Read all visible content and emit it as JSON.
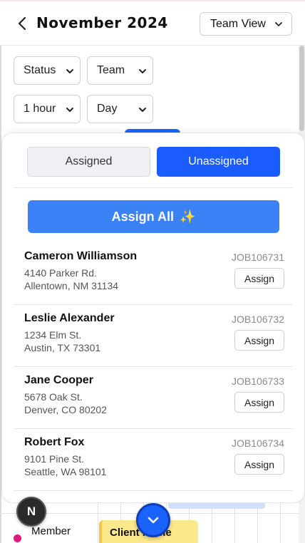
{
  "header": {
    "title": "November 2024",
    "view_select": "Team View"
  },
  "filters": {
    "status": "Status",
    "team": "Team",
    "interval": "1 hour",
    "range": "Day"
  },
  "sheet": {
    "tabs": {
      "assigned": "Assigned",
      "unassigned": "Unassigned",
      "active": "unassigned"
    },
    "assign_all": "Assign All",
    "assign_all_icon": "✨",
    "jobs": [
      {
        "name": "Cameron Williamson",
        "address_line1": "4140 Parker Rd.",
        "address_line2": "Allentown, NM 31134",
        "job_id": "JOB106731",
        "action": "Assign"
      },
      {
        "name": "Leslie Alexander",
        "address_line1": "1234 Elm St.",
        "address_line2": "Austin, TX 73301",
        "job_id": "JOB106732",
        "action": "Assign"
      },
      {
        "name": "Jane Cooper",
        "address_line1": "5678 Oak St.",
        "address_line2": "Denver, CO 80202",
        "job_id": "JOB106733",
        "action": "Assign"
      },
      {
        "name": "Robert Fox",
        "address_line1": "9101 Pine St.",
        "address_line2": "Seattle, WA 98101",
        "job_id": "JOB106734",
        "action": "Assign"
      }
    ]
  },
  "background_schedule": {
    "member_label": "Member",
    "client_card": "Client Name"
  },
  "avatar_initial": "N",
  "colors": {
    "accent": "#1a5cff",
    "assign_all": "#3b82f6",
    "member_dot": "#e0187a",
    "client_card": "#fbe88b"
  }
}
